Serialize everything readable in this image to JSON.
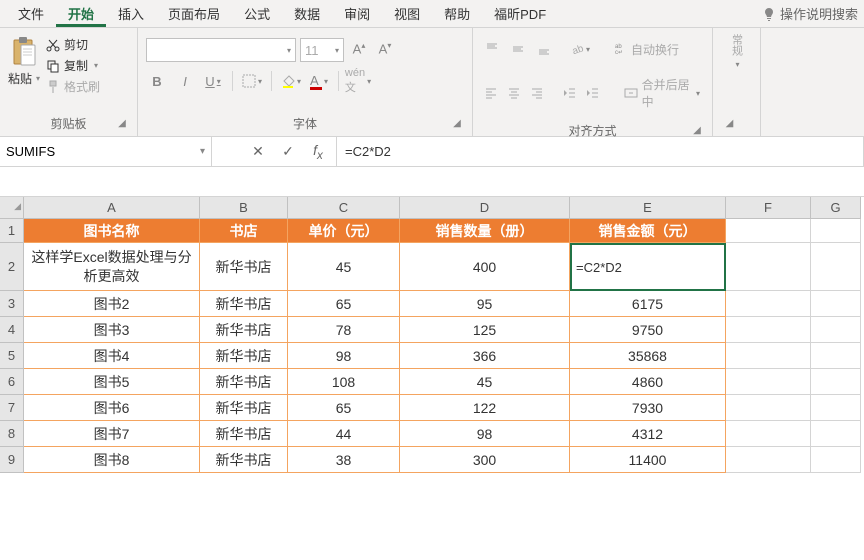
{
  "menu": {
    "items": [
      "文件",
      "开始",
      "插入",
      "页面布局",
      "公式",
      "数据",
      "审阅",
      "视图",
      "帮助",
      "福昕PDF"
    ],
    "active_index": 1,
    "tell_me": "操作说明搜索"
  },
  "ribbon": {
    "clipboard": {
      "paste": "粘贴",
      "cut": "剪切",
      "copy": "复制",
      "format_painter": "格式刷",
      "group_label": "剪贴板"
    },
    "font": {
      "font_name": "",
      "font_size": "11",
      "group_label": "字体"
    },
    "alignment": {
      "wrap_text": "自动换行",
      "merge_center": "合并后居中",
      "group_label": "对齐方式"
    },
    "number": {
      "label": "常规"
    }
  },
  "formula_bar": {
    "name_box": "SUMIFS",
    "formula": "=C2*D2"
  },
  "grid": {
    "col_headers": [
      "A",
      "B",
      "C",
      "D",
      "E",
      "F",
      "G"
    ],
    "row_headers": [
      1,
      2,
      3,
      4,
      5,
      6,
      7,
      8,
      9
    ],
    "header_row": [
      "图书名称",
      "书店",
      "单价（元）",
      "销售数量（册）",
      "销售金额（元）"
    ],
    "active_cell_value": "=C2*D2",
    "rows": [
      {
        "a": "这样学Excel数据处理与分析更高效",
        "b": "新华书店",
        "c": "45",
        "d": "400",
        "e": ""
      },
      {
        "a": "图书2",
        "b": "新华书店",
        "c": "65",
        "d": "95",
        "e": "6175"
      },
      {
        "a": "图书3",
        "b": "新华书店",
        "c": "78",
        "d": "125",
        "e": "9750"
      },
      {
        "a": "图书4",
        "b": "新华书店",
        "c": "98",
        "d": "366",
        "e": "35868"
      },
      {
        "a": "图书5",
        "b": "新华书店",
        "c": "108",
        "d": "45",
        "e": "4860"
      },
      {
        "a": "图书6",
        "b": "新华书店",
        "c": "65",
        "d": "122",
        "e": "7930"
      },
      {
        "a": "图书7",
        "b": "新华书店",
        "c": "44",
        "d": "98",
        "e": "4312"
      },
      {
        "a": "图书8",
        "b": "新华书店",
        "c": "38",
        "d": "300",
        "e": "11400"
      }
    ]
  },
  "chart_data": {
    "type": "table",
    "columns": [
      "图书名称",
      "书店",
      "单价（元）",
      "销售数量（册）",
      "销售金额（元）"
    ],
    "rows": [
      [
        "这样学Excel数据处理与分析更高效",
        "新华书店",
        45,
        400,
        null
      ],
      [
        "图书2",
        "新华书店",
        65,
        95,
        6175
      ],
      [
        "图书3",
        "新华书店",
        78,
        125,
        9750
      ],
      [
        "图书4",
        "新华书店",
        98,
        366,
        35868
      ],
      [
        "图书5",
        "新华书店",
        108,
        45,
        4860
      ],
      [
        "图书6",
        "新华书店",
        65,
        122,
        7930
      ],
      [
        "图书7",
        "新华书店",
        44,
        98,
        4312
      ],
      [
        "图书8",
        "新华书店",
        38,
        300,
        11400
      ]
    ]
  }
}
